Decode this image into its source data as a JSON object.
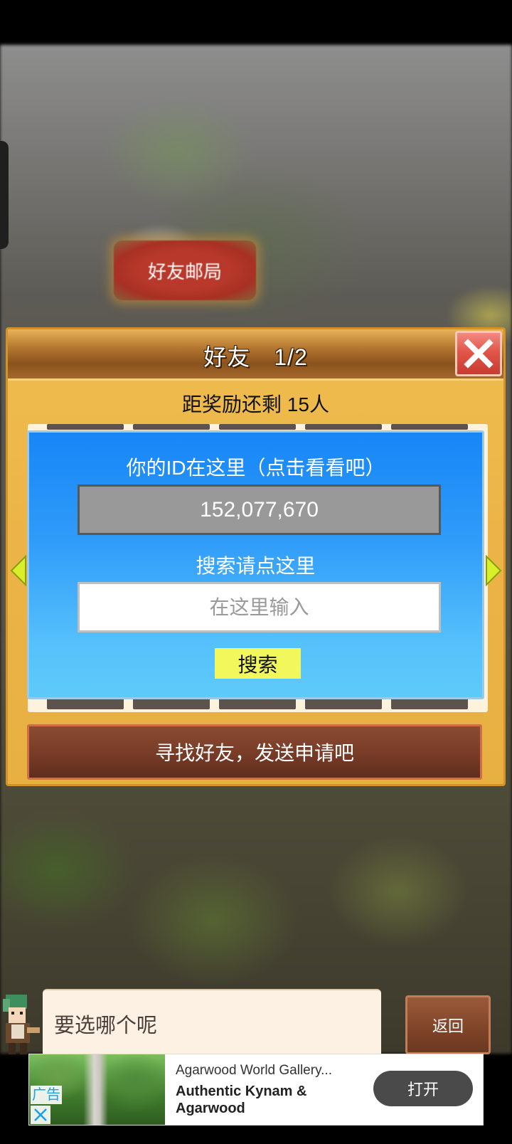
{
  "scene": {
    "post_office_label": "好友邮局"
  },
  "friend_panel": {
    "title": "好友　1/2",
    "reward_text": "距奖励还剩 15人",
    "id_label": "你的ID在这里（点击看看吧）",
    "player_id": "152,077,670",
    "search_label": "搜索请点这里",
    "search_placeholder": "在这里输入",
    "search_value": "",
    "search_button": "搜索",
    "find_friends_button": "寻找好友，发送申请吧"
  },
  "dialog": {
    "text": "要选哪个呢",
    "back_button": "返回"
  },
  "ad": {
    "tag": "广告",
    "small_title": "Agarwood World Gallery...",
    "big_title": "Authentic Kynam & Agarwood",
    "open_button": "打开"
  },
  "icons": {
    "close": "close-icon",
    "left_arrow": "arrow-left-icon",
    "right_arrow": "arrow-right-icon",
    "ad_close": "close-icon"
  },
  "colors": {
    "panel_gold": "#ecb448",
    "blue_panel": "#1786f7",
    "search_button": "#f2f85c",
    "close_red": "#e2564a",
    "find_button_brown": "#7a3d28"
  }
}
